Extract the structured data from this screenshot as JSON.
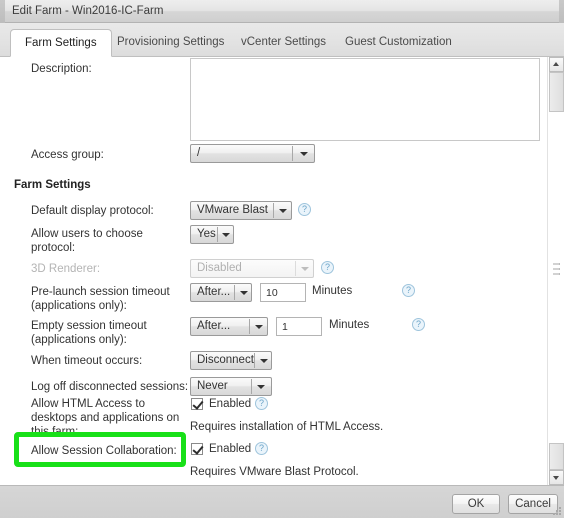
{
  "window": {
    "title": "Edit Farm - Win2016-IC-Farm"
  },
  "tabs": [
    {
      "label": "Farm Settings",
      "active": true
    },
    {
      "label": "Provisioning Settings",
      "active": false
    },
    {
      "label": "vCenter Settings",
      "active": false
    },
    {
      "label": "Guest Customization",
      "active": false
    }
  ],
  "form": {
    "description_label": "Description:",
    "description_value": "",
    "access_group_label": "Access group:",
    "access_group_value": "/",
    "section_title": "Farm Settings",
    "default_display_protocol_label": "Default display protocol:",
    "default_display_protocol_value": "VMware Blast",
    "allow_users_choose_protocol_label": "Allow users to choose protocol:",
    "allow_users_choose_protocol_value": "Yes",
    "renderer_3d_label": "3D Renderer:",
    "renderer_3d_value": "Disabled",
    "prelaunch_timeout_label": "Pre-launch session timeout (applications only):",
    "prelaunch_timeout_mode": "After...",
    "prelaunch_timeout_minutes": "10",
    "prelaunch_timeout_units": "Minutes",
    "empty_timeout_label": "Empty session timeout (applications only):",
    "empty_timeout_mode": "After...",
    "empty_timeout_minutes": "1",
    "empty_timeout_units": "Minutes",
    "when_timeout_occurs_label": "When timeout occurs:",
    "when_timeout_occurs_value": "Disconnect",
    "log_off_disconnected_label": "Log off disconnected sessions:",
    "log_off_disconnected_value": "Never",
    "html_access_label": "Allow HTML Access to desktops and applications on this farm:",
    "html_access_checkbox_label": "Enabled",
    "html_access_note": "Requires installation of HTML Access.",
    "session_collaboration_label": "Allow Session Collaboration:",
    "session_collaboration_checkbox_label": "Enabled",
    "session_collaboration_note": "Requires VMware Blast Protocol.",
    "help_icon": "help-circle-icon"
  },
  "footer": {
    "ok_label": "OK",
    "cancel_label": "Cancel"
  },
  "colors": {
    "highlight": "#18e018",
    "help_icon": "#6aa3c7"
  }
}
